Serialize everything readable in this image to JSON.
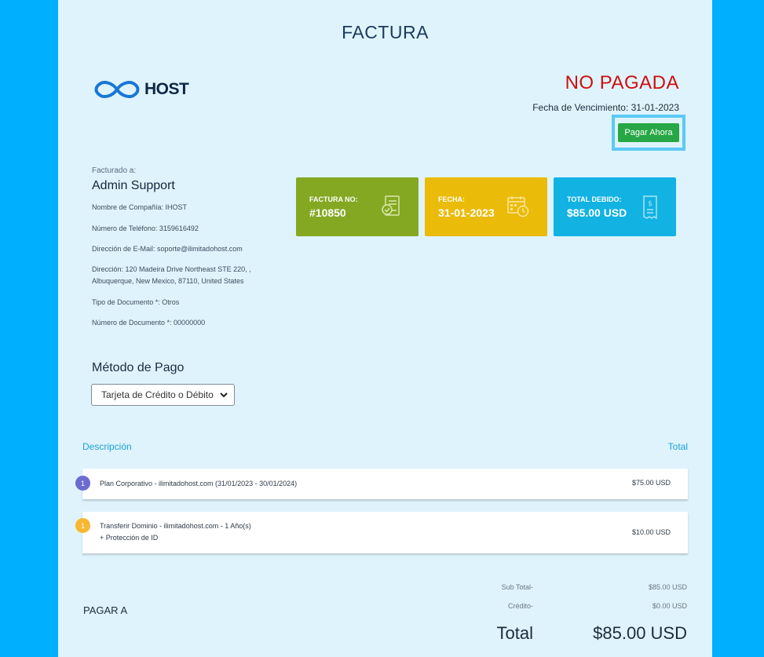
{
  "title": "FACTURA",
  "logo": {
    "text": "HOST"
  },
  "status": "NO PAGADA",
  "due_date": "Fecha de Vencimiento: 31-01-2023",
  "pay_button": "Pagar Ahora",
  "billed_to": {
    "label": "Facturado a:",
    "name": "Admin Support",
    "company": "Nombre de Compañía: IHOST",
    "phone": "Número de Teléfono: 3159616492",
    "email": "Dirección de E-Mail: soporte@ilimitadohost.com",
    "address_line1": "Dirección: 120 Madeira Drive Northeast STE 220, ,",
    "address_line2": "Albuquerque, New Mexico, 87110, United States",
    "doc_type": "Tipo de Documento *: Otros",
    "doc_number": "Número de Documento *: 00000000"
  },
  "cards": [
    {
      "label": "FACTURA NO:",
      "value": "#10850",
      "icon": "invoice-check-icon",
      "color": "#84a822"
    },
    {
      "label": "FECHA:",
      "value": "31-01-2023",
      "icon": "calendar-clock-icon",
      "color": "#eabb09"
    },
    {
      "label": "TOTAL DEBIDO:",
      "value": "$85.00 USD",
      "icon": "receipt-icon",
      "color": "#12b2e3"
    }
  ],
  "payment_method": {
    "title": "Método de Pago",
    "selected": "Tarjeta de Crédito o Débito"
  },
  "table": {
    "col_description": "Descripción",
    "col_total": "Total",
    "rows": [
      {
        "qty": "1",
        "description": "Plan Corporativo - ilimitadohost.com (31/01/2023 - 30/01/2024)",
        "description2": "",
        "amount": "$75.00 USD"
      },
      {
        "qty": "1",
        "description": "Transferir Dominio - ilimitadohost.com - 1 Año(s)",
        "description2": "+ Protección de ID",
        "amount": "$10.00 USD"
      }
    ]
  },
  "pay_to": "PAGAR A",
  "summary": {
    "subtotal_label": "Sub Total-",
    "subtotal_value": "$85.00 USD",
    "credit_label": "Crédito-",
    "credit_value": "$0.00 USD",
    "total_label": "Total",
    "total_value": "$85.00 USD"
  },
  "colors": {
    "background": "#00b0ff",
    "page": "#dff3fd",
    "status": "#cc1010",
    "pay_button": "#27a745",
    "accent": "#1ba3d9"
  }
}
